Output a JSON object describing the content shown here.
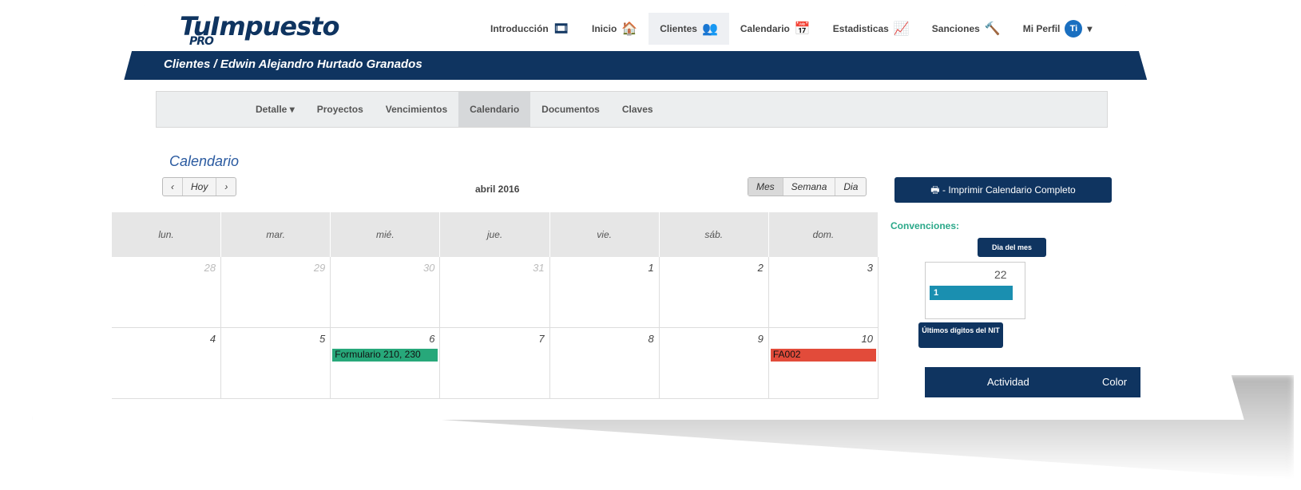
{
  "logo": {
    "main": "TuImpuesto",
    "sub": "PRO"
  },
  "nav": [
    {
      "label": "Introducción",
      "icon": "film-icon",
      "glyph": "🎞"
    },
    {
      "label": "Inicio",
      "icon": "home-icon",
      "glyph": "🏠"
    },
    {
      "label": "Clientes",
      "icon": "users-icon",
      "glyph": "👥"
    },
    {
      "label": "Calendario",
      "icon": "calendar-icon",
      "glyph": "📅"
    },
    {
      "label": "Estadisticas",
      "icon": "chart-line-icon",
      "glyph": "📈"
    },
    {
      "label": "Sanciones",
      "icon": "gavel-icon",
      "glyph": "🔨"
    },
    {
      "label": "Mi Perfil",
      "icon": "avatar",
      "glyph": "Ti"
    }
  ],
  "breadcrumb": "Clientes / Edwin Alejandro Hurtado Granados",
  "subnav": {
    "detail": "Detalle",
    "items": [
      "Proyectos",
      "Vencimientos",
      "Calendario",
      "Documentos",
      "Claves"
    ]
  },
  "calendar": {
    "title": "Calendario",
    "today": "Hoy",
    "month": "abril 2016",
    "views": [
      "Mes",
      "Semana",
      "Dia"
    ],
    "print": "Imprimir Calendario Completo",
    "days": [
      "lun.",
      "mar.",
      "mié.",
      "jue.",
      "vie.",
      "sáb.",
      "dom."
    ],
    "weeks": [
      [
        "28",
        "29",
        "30",
        "31",
        "1",
        "2",
        "3"
      ],
      [
        "4",
        "5",
        "6",
        "7",
        "8",
        "9",
        "10"
      ]
    ],
    "events": {
      "formulario": "Formulario 210, 230",
      "fa": "FA002"
    }
  },
  "legend": {
    "title": "Convenciones:",
    "day_tip": "Dia del mes",
    "day_num": "22",
    "bar_num": "1",
    "nit_tip": "Últimos dígitos del NIT",
    "table_col1": "Actividad",
    "table_col2": "Color"
  }
}
